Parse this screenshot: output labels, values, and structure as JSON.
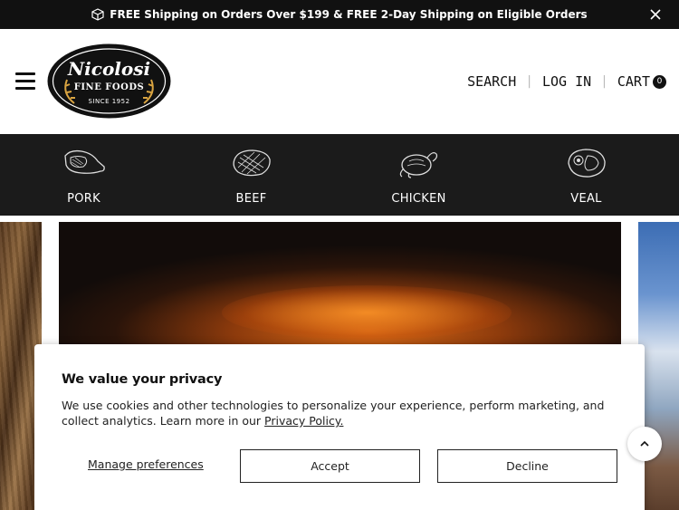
{
  "announcement": {
    "text": "FREE Shipping on Orders Over $199 & FREE 2-Day Shipping on Eligible Orders",
    "icon": "box-icon",
    "close_icon": "close-icon"
  },
  "header": {
    "menu_icon": "hamburger-menu-icon",
    "logo": {
      "name": "Nicolosi",
      "tagline": "FINE FOODS",
      "since": "SINCE 1952"
    },
    "nav": {
      "search": "SEARCH",
      "login": "LOG IN",
      "cart": "CART",
      "cart_count": "0"
    }
  },
  "categories": [
    {
      "label": "PORK",
      "icon": "pork-chop-icon"
    },
    {
      "label": "BEEF",
      "icon": "steak-icon"
    },
    {
      "label": "CHICKEN",
      "icon": "roast-chicken-icon"
    },
    {
      "label": "VEAL",
      "icon": "veal-cut-icon"
    }
  ],
  "carousel": {
    "arrow_icon": "chevron-up-icon"
  },
  "privacy": {
    "title": "We value your privacy",
    "body": "We use cookies and other technologies to personalize your experience, perform marketing, and collect analytics. Learn more in our ",
    "policy_link": "Privacy Policy.",
    "manage": "Manage preferences",
    "accept": "Accept",
    "decline": "Decline"
  },
  "colors": {
    "announcement_bg": "#111111",
    "category_bar_bg": "#1b1b1b",
    "text": "#111111"
  }
}
